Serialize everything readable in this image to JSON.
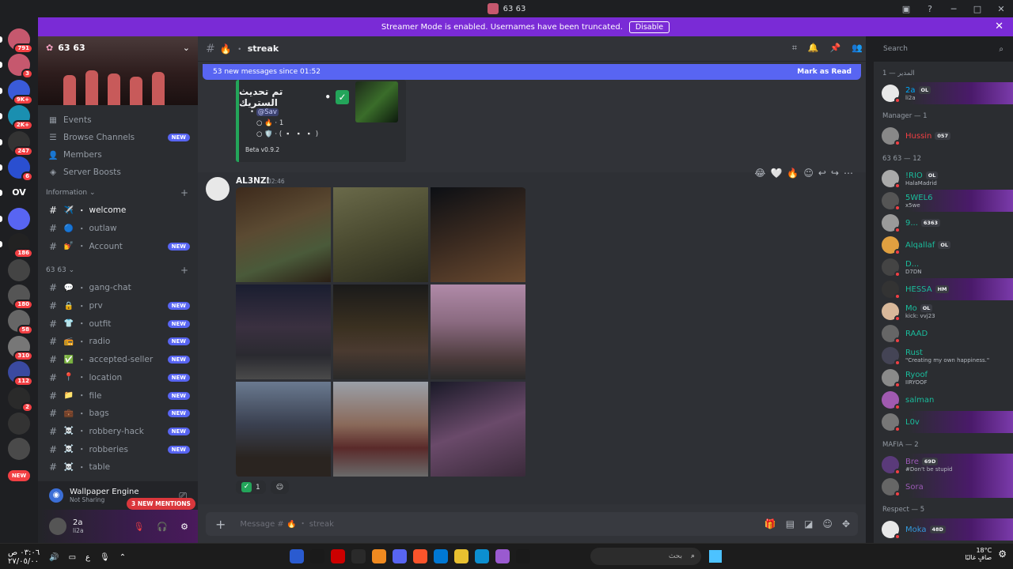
{
  "window": {
    "title": "63 63"
  },
  "banner": {
    "text": "Streamer Mode is enabled. Usernames have been truncated.",
    "button": "Disable"
  },
  "guilds": [
    {
      "badge": "791"
    },
    {
      "badge": "3"
    },
    {
      "badge": "9K+"
    },
    {
      "badge": "2K+"
    },
    {
      "badge": "247"
    },
    {
      "badge": "6"
    },
    {
      "label": "OV"
    },
    {
      "badge": ""
    },
    {
      "badge": "186"
    },
    {
      "badge": ""
    },
    {
      "badge": "180"
    },
    {
      "badge": "58"
    },
    {
      "badge": "310"
    },
    {
      "badge": "112"
    },
    {
      "badge": "2"
    },
    {
      "badge": ""
    },
    {
      "badge": ""
    },
    {
      "label": "NEW"
    }
  ],
  "server": {
    "name": "63 63"
  },
  "nav": [
    {
      "label": "Events",
      "icon": "calendar-icon"
    },
    {
      "label": "Browse Channels",
      "icon": "browse-icon",
      "badge": "NEW"
    },
    {
      "label": "Members",
      "icon": "members-icon"
    },
    {
      "label": "Server Boosts",
      "icon": "boost-icon"
    }
  ],
  "categories": [
    {
      "name": "Information",
      "channels": [
        {
          "emoji": "✈️",
          "name": "welcome",
          "active": true
        },
        {
          "emoji": "🔵",
          "name": "outlaw"
        },
        {
          "emoji": "💅",
          "name": "Account",
          "badge": "NEW"
        }
      ]
    },
    {
      "name": "63 63",
      "channels": [
        {
          "emoji": "💬",
          "name": "gang-chat"
        },
        {
          "emoji": "🔒",
          "name": "prv",
          "badge": "NEW"
        },
        {
          "emoji": "👕",
          "name": "outfit",
          "badge": "NEW"
        },
        {
          "emoji": "📻",
          "name": "radio",
          "badge": "NEW"
        },
        {
          "emoji": "✅",
          "name": "accepted-seller",
          "badge": "NEW"
        },
        {
          "emoji": "📍",
          "name": "location",
          "badge": "NEW"
        },
        {
          "emoji": "📁",
          "name": "file",
          "badge": "NEW"
        },
        {
          "emoji": "💼",
          "name": "bags",
          "badge": "NEW"
        },
        {
          "emoji": "☠️",
          "name": "robbery-hack",
          "badge": "NEW"
        },
        {
          "emoji": "☠️",
          "name": "robberies",
          "badge": "NEW"
        },
        {
          "emoji": "☠️",
          "name": "table"
        }
      ]
    }
  ],
  "mentions": "3 NEW MENTIONS",
  "activity": {
    "title": "Wallpaper Engine",
    "sub": "Not Sharing"
  },
  "user": {
    "name": "2a",
    "sub": "li2a"
  },
  "channel": {
    "name": "streak",
    "emoji": "🔥"
  },
  "newmsgs": {
    "text": "53 new messages since 01:52",
    "action": "Mark as Read"
  },
  "embed": {
    "title": "تم تحديث الستريك",
    "mention": "@Sav",
    "line1": "🔥 · 1",
    "line2": "🛡️ · ( ▫️ ▫️ ▫️ )",
    "footer": "Beta v0.9.2"
  },
  "message": {
    "author": "AL3NZI",
    "time": "02:46",
    "reaction_count": "1"
  },
  "composer": {
    "placeholder": "Message # 🔥 ・ streak"
  },
  "search": {
    "placeholder": "Search"
  },
  "member_groups": [
    {
      "title": "المدير — 1",
      "members": [
        {
          "name": "2a",
          "tag": "OL",
          "status": "li2a",
          "color": "#00a8fc",
          "hl": true
        }
      ]
    },
    {
      "title": "Manager — 1",
      "members": [
        {
          "name": "Hussin",
          "tag": "057",
          "status": "",
          "color": "#f23f43"
        }
      ]
    },
    {
      "title": "63 63 — 12",
      "members": [
        {
          "name": "!RIO",
          "tag": "OL",
          "status": "HalaMadrid",
          "color": "#1abc9c"
        },
        {
          "name": "5WEL6",
          "tag": "",
          "status": "x5we",
          "color": "#1abc9c",
          "hl": true
        },
        {
          "name": "9...",
          "tag": "6363",
          "status": "",
          "color": "#1abc9c"
        },
        {
          "name": "Alqallaf",
          "tag": "OL",
          "status": "",
          "color": "#1abc9c"
        },
        {
          "name": "D...",
          "tag": "",
          "status": "D7DN",
          "color": "#1abc9c"
        },
        {
          "name": "HESSA",
          "tag": "HM",
          "status": "",
          "color": "#1abc9c",
          "hl": true
        },
        {
          "name": "Mo",
          "tag": "OL",
          "status": "kick: vvj23",
          "color": "#1abc9c"
        },
        {
          "name": "RAAD",
          "tag": "",
          "status": "",
          "color": "#1abc9c"
        },
        {
          "name": "Rust",
          "tag": "",
          "status": "\"Creating my own happiness.\"",
          "color": "#1abc9c"
        },
        {
          "name": "Ryoof",
          "tag": "",
          "status": "IIRYOOF",
          "color": "#1abc9c"
        },
        {
          "name": "salman",
          "tag": "",
          "status": "",
          "color": "#1abc9c"
        },
        {
          "name": "L0v",
          "tag": "",
          "status": "",
          "color": "#1abc9c",
          "hl": true
        }
      ]
    },
    {
      "title": "MAFIA — 2",
      "members": [
        {
          "name": "Bre",
          "tag": "69D",
          "status": "#Don't be stupid",
          "color": "#9b59b6",
          "hl": true
        },
        {
          "name": "Sora",
          "tag": "",
          "status": "",
          "color": "#9b59b6",
          "hl": true
        }
      ]
    },
    {
      "title": "Respect — 5",
      "members": [
        {
          "name": "Moka",
          "tag": "48D",
          "status": "",
          "color": "#3498db",
          "hl": true
        }
      ]
    }
  ],
  "taskbar": {
    "search": "بحث",
    "weather": "18°C",
    "weather_sub": "صافٍ غالبًا",
    "time": "٠٣:٠٦ ص",
    "date": "٢٧/٠٥/٠٠",
    "lang": "ع"
  }
}
